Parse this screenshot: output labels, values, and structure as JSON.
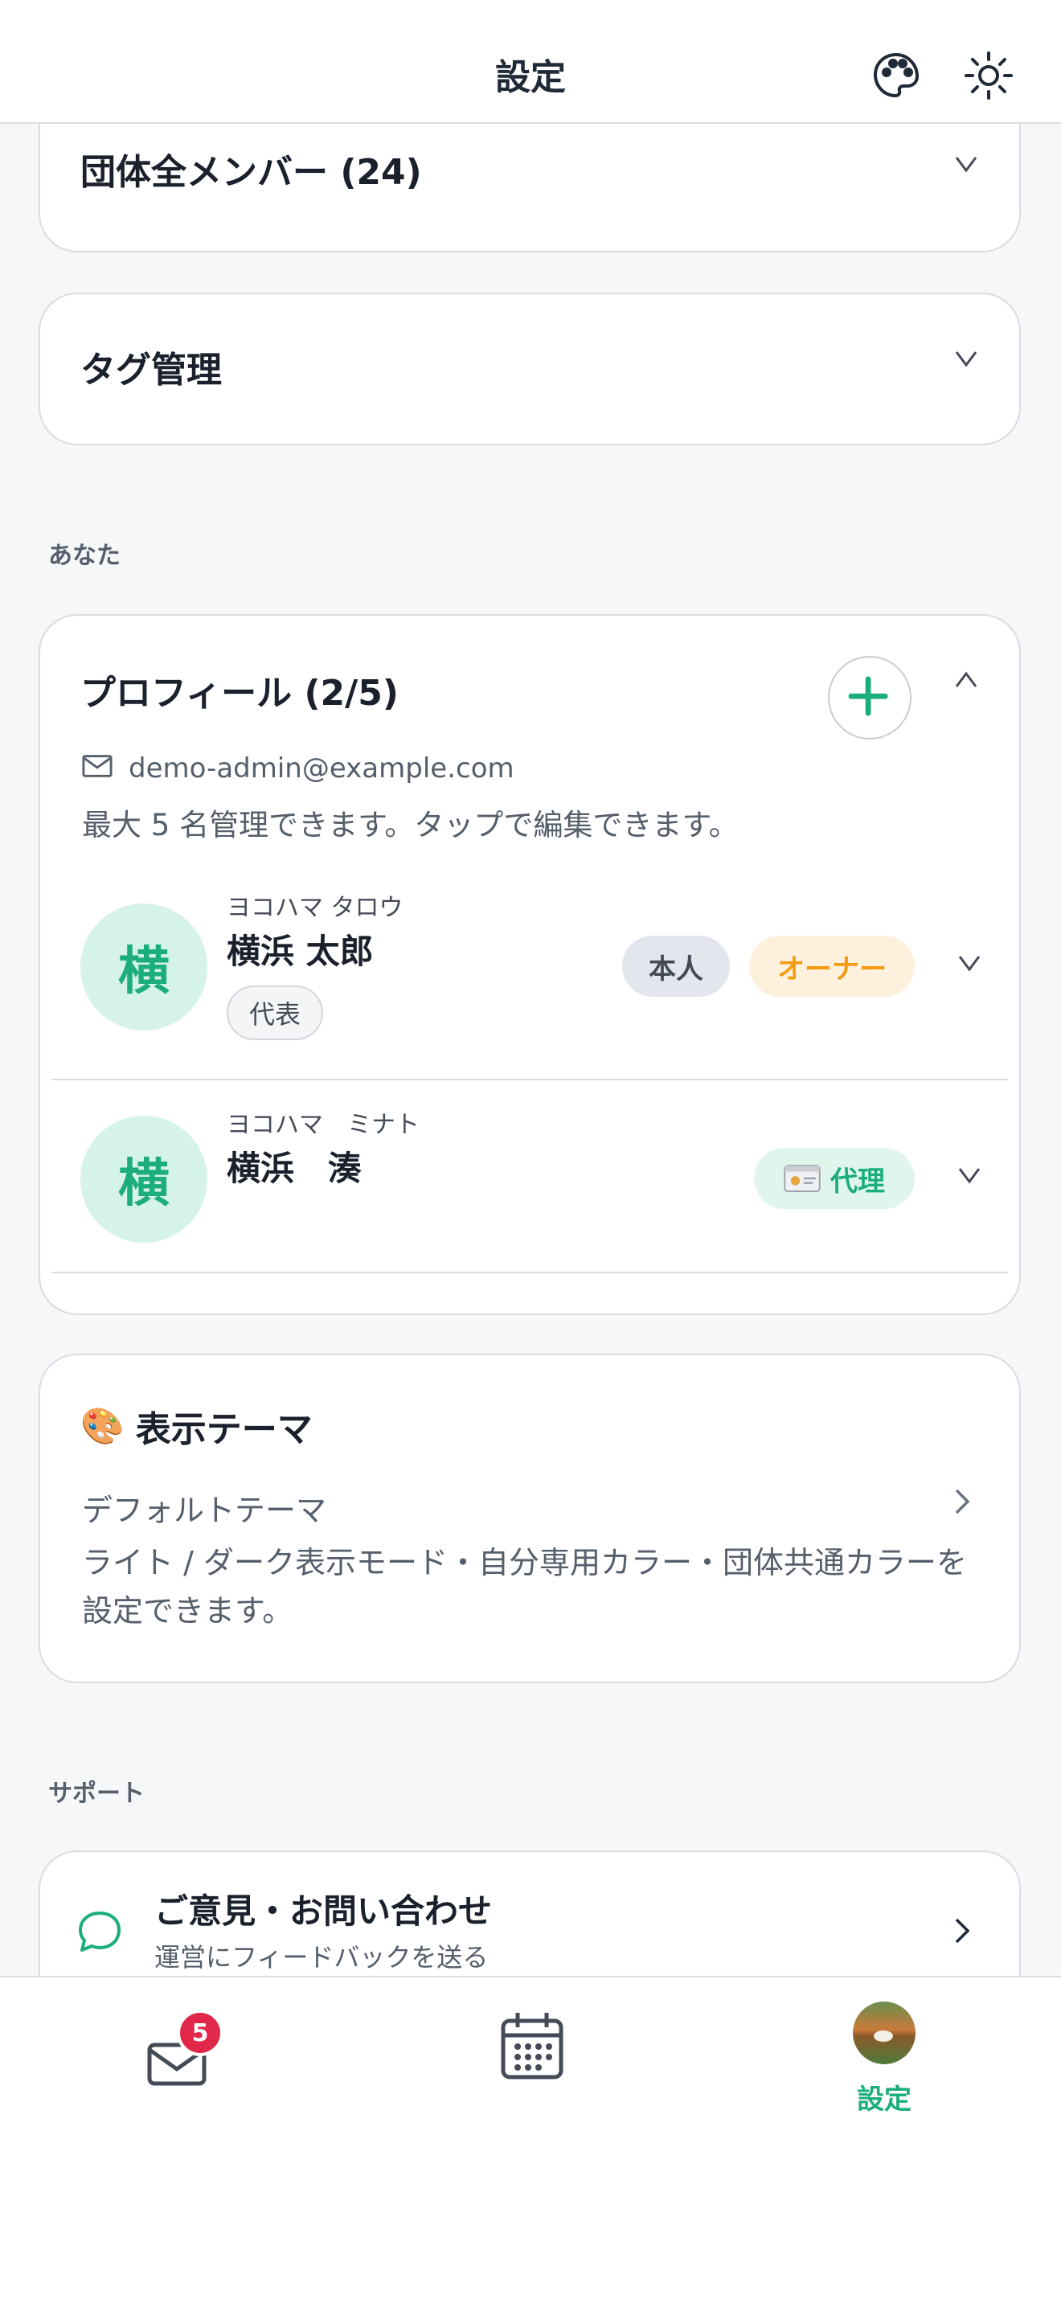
{
  "header": {
    "title": "設定",
    "palette_icon": "palette-icon",
    "theme_icon": "sun-icon"
  },
  "members_card": {
    "title": "団体全メンバー (24)"
  },
  "tags_card": {
    "title": "タグ管理"
  },
  "section_you": "あなた",
  "profile_card": {
    "title": "プロフィール (2/5)",
    "email": "demo-admin@example.com",
    "note": "最大 5 名管理できます。タップで編集できます。",
    "profiles": [
      {
        "avatar": "横",
        "kana": "ヨコハマ タロウ",
        "name": "横浜 太郎",
        "tag": "代表",
        "badge_self": "本人",
        "badge_owner": "オーナー"
      },
      {
        "avatar": "横",
        "kana": "ヨコハマ　ミナト",
        "name": "横浜　湊",
        "badge_proxy": "代理"
      }
    ]
  },
  "theme_card": {
    "title": "表示テーマ",
    "emoji": "🎨",
    "current": "デフォルトテーマ",
    "description": "ライト / ダーク表示モード・自分専用カラー・団体共通カラーを設定できます。"
  },
  "section_support": "サポート",
  "support_card": {
    "title": "ご意見・お問い合わせ",
    "subtitle": "運営にフィードバックを送る"
  },
  "tabbar": {
    "mail_badge": "5",
    "settings_label": "設定"
  },
  "colors": {
    "accent_green": "#1cae7a",
    "owner_orange": "#f39c12",
    "badge_red": "#e1284b"
  }
}
